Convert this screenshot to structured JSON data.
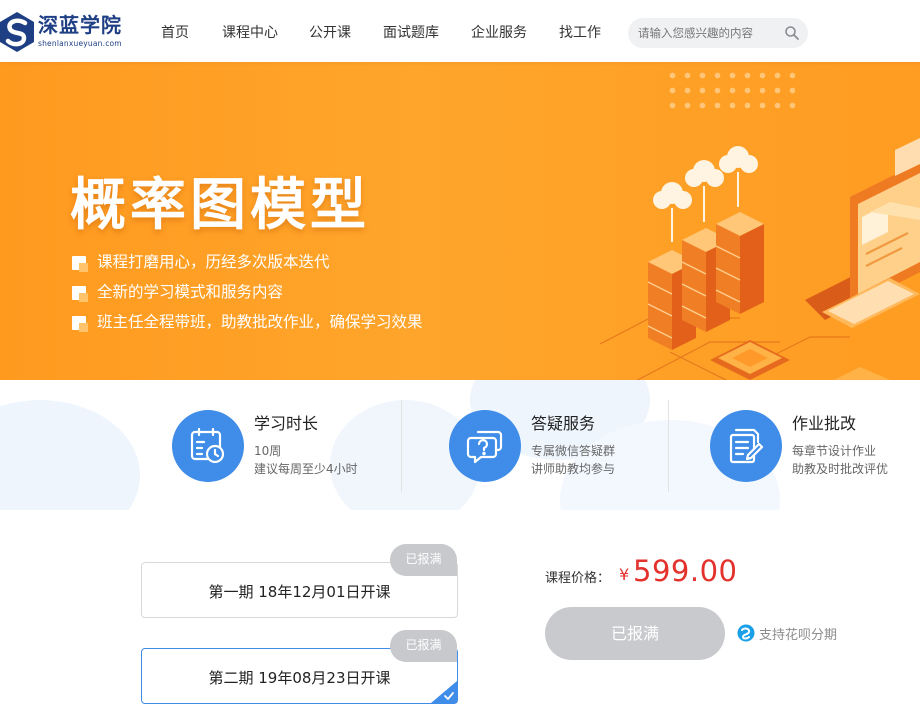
{
  "brand": {
    "name": "深蓝学院",
    "domain": "shenlanxueyuan.com",
    "colors": {
      "primary": "#1f3f85",
      "accent": "#3f8de8",
      "banner": "#ffa020",
      "price": "#e3322c"
    }
  },
  "nav": {
    "items": [
      "首页",
      "课程中心",
      "公开课",
      "面试题库",
      "企业服务",
      "找工作"
    ]
  },
  "search": {
    "placeholder": "请输入您感兴趣的内容",
    "icon": "search-icon"
  },
  "banner": {
    "title": "概率图模型",
    "features": [
      "课程打磨用心，历经多次版本迭代",
      "全新的学习模式和服务内容",
      "班主任全程带班，助教批改作业，确保学习效果"
    ]
  },
  "info": [
    {
      "title": "学习时长",
      "lines": [
        "10周",
        "建议每周至少4小时"
      ],
      "icon": "calendar-clock-icon"
    },
    {
      "title": "答疑服务",
      "lines": [
        "专属微信答疑群",
        "讲师助教均参与"
      ],
      "icon": "chat-question-icon"
    },
    {
      "title": "作业批改",
      "lines": [
        "每章节设计作业",
        "助教及时批改评优"
      ],
      "icon": "document-edit-icon"
    }
  ],
  "sessions": [
    {
      "label": "第一期 18年12月01日开课",
      "tag": "已报满",
      "selected": false
    },
    {
      "label": "第二期 19年08月23日开课",
      "tag": "已报满",
      "selected": true
    }
  ],
  "pricing": {
    "label": "课程价格：",
    "symbol": "¥",
    "value": "599.00",
    "button": "已报满",
    "installment": "支持花呗分期"
  }
}
